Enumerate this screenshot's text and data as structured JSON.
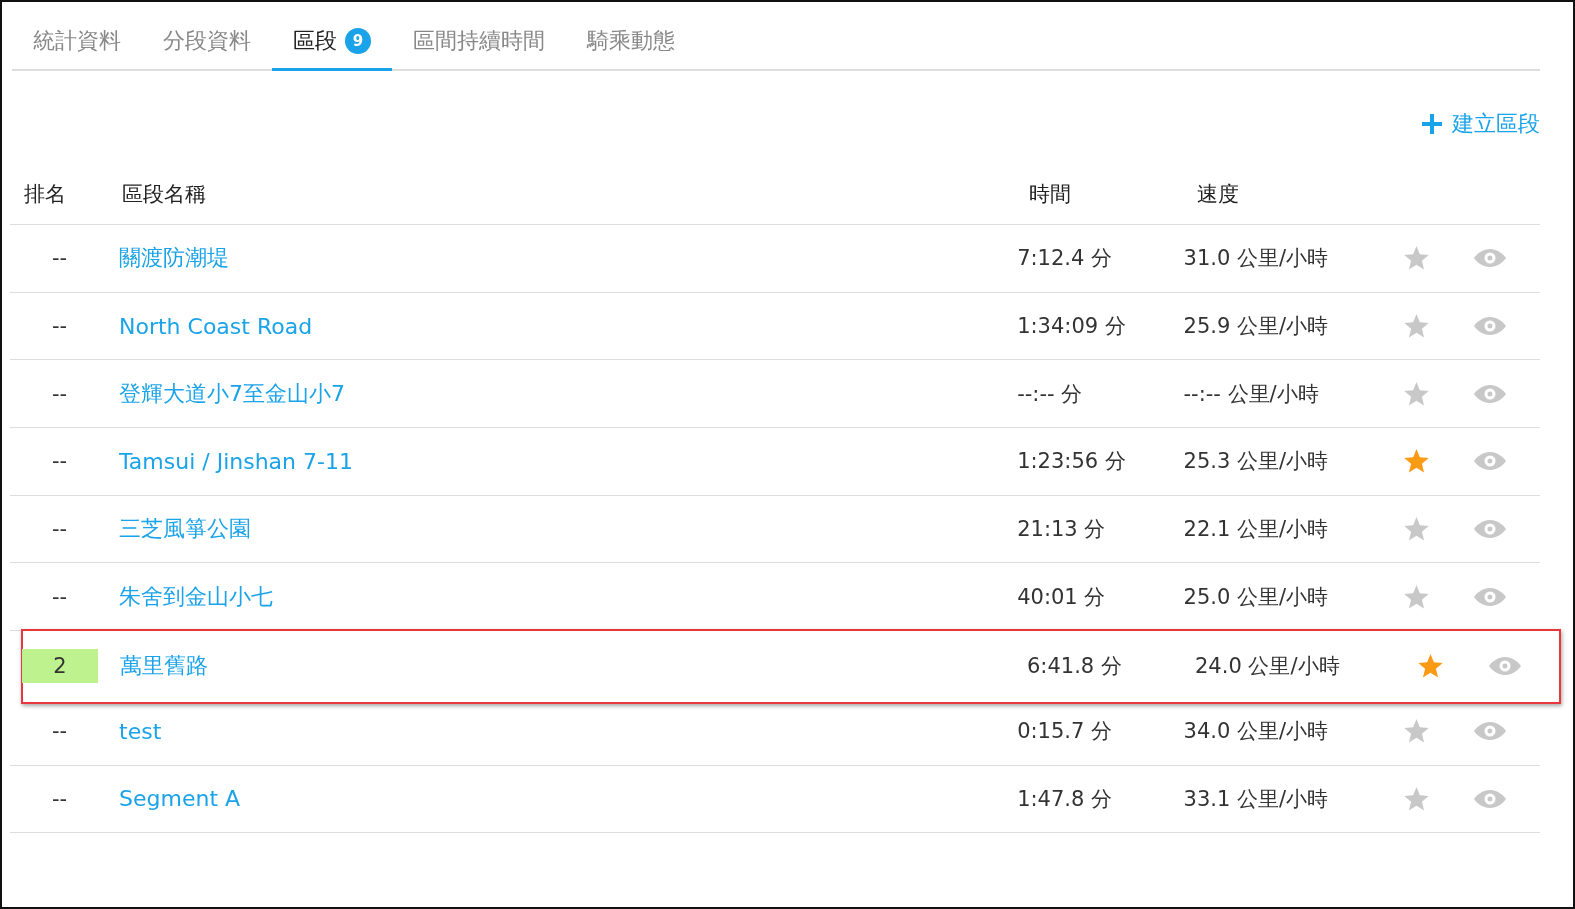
{
  "tabs": [
    {
      "label": "統計資料",
      "selected": false
    },
    {
      "label": "分段資料",
      "selected": false
    },
    {
      "label": "區段",
      "selected": true,
      "badge": "9"
    },
    {
      "label": "區間持續時間",
      "selected": false
    },
    {
      "label": "騎乘動態",
      "selected": false
    }
  ],
  "create_button": "建立區段",
  "table": {
    "columns": [
      "排名",
      "區段名稱",
      "時間",
      "速度"
    ],
    "rows": [
      {
        "rank": "--",
        "name": "關渡防潮堤",
        "time": "7:12.4 分",
        "speed": "31.0 公里/小時",
        "starred": false,
        "ranked": false,
        "highlighted": false
      },
      {
        "rank": "--",
        "name": "North Coast Road",
        "time": "1:34:09 分",
        "speed": "25.9 公里/小時",
        "starred": false,
        "ranked": false,
        "highlighted": false
      },
      {
        "rank": "--",
        "name": "登輝大道小7至金山小7",
        "time": "--:-- 分",
        "speed": "--:-- 公里/小時",
        "starred": false,
        "ranked": false,
        "highlighted": false
      },
      {
        "rank": "--",
        "name": "Tamsui / Jinshan 7-11",
        "time": "1:23:56 分",
        "speed": "25.3 公里/小時",
        "starred": true,
        "ranked": false,
        "highlighted": false
      },
      {
        "rank": "--",
        "name": "三芝風箏公園",
        "time": "21:13 分",
        "speed": "22.1 公里/小時",
        "starred": false,
        "ranked": false,
        "highlighted": false
      },
      {
        "rank": "--",
        "name": "朱舍到金山小七",
        "time": "40:01 分",
        "speed": "25.0 公里/小時",
        "starred": false,
        "ranked": false,
        "highlighted": false
      },
      {
        "rank": "2",
        "name": "萬里舊路",
        "time": "6:41.8 分",
        "speed": "24.0 公里/小時",
        "starred": true,
        "ranked": true,
        "highlighted": true
      },
      {
        "rank": "--",
        "name": "test",
        "time": "0:15.7 分",
        "speed": "34.0 公里/小時",
        "starred": false,
        "ranked": false,
        "highlighted": false
      },
      {
        "rank": "--",
        "name": "Segment A",
        "time": "1:47.8 分",
        "speed": "33.1 公里/小時",
        "starred": false,
        "ranked": false,
        "highlighted": false
      }
    ]
  }
}
